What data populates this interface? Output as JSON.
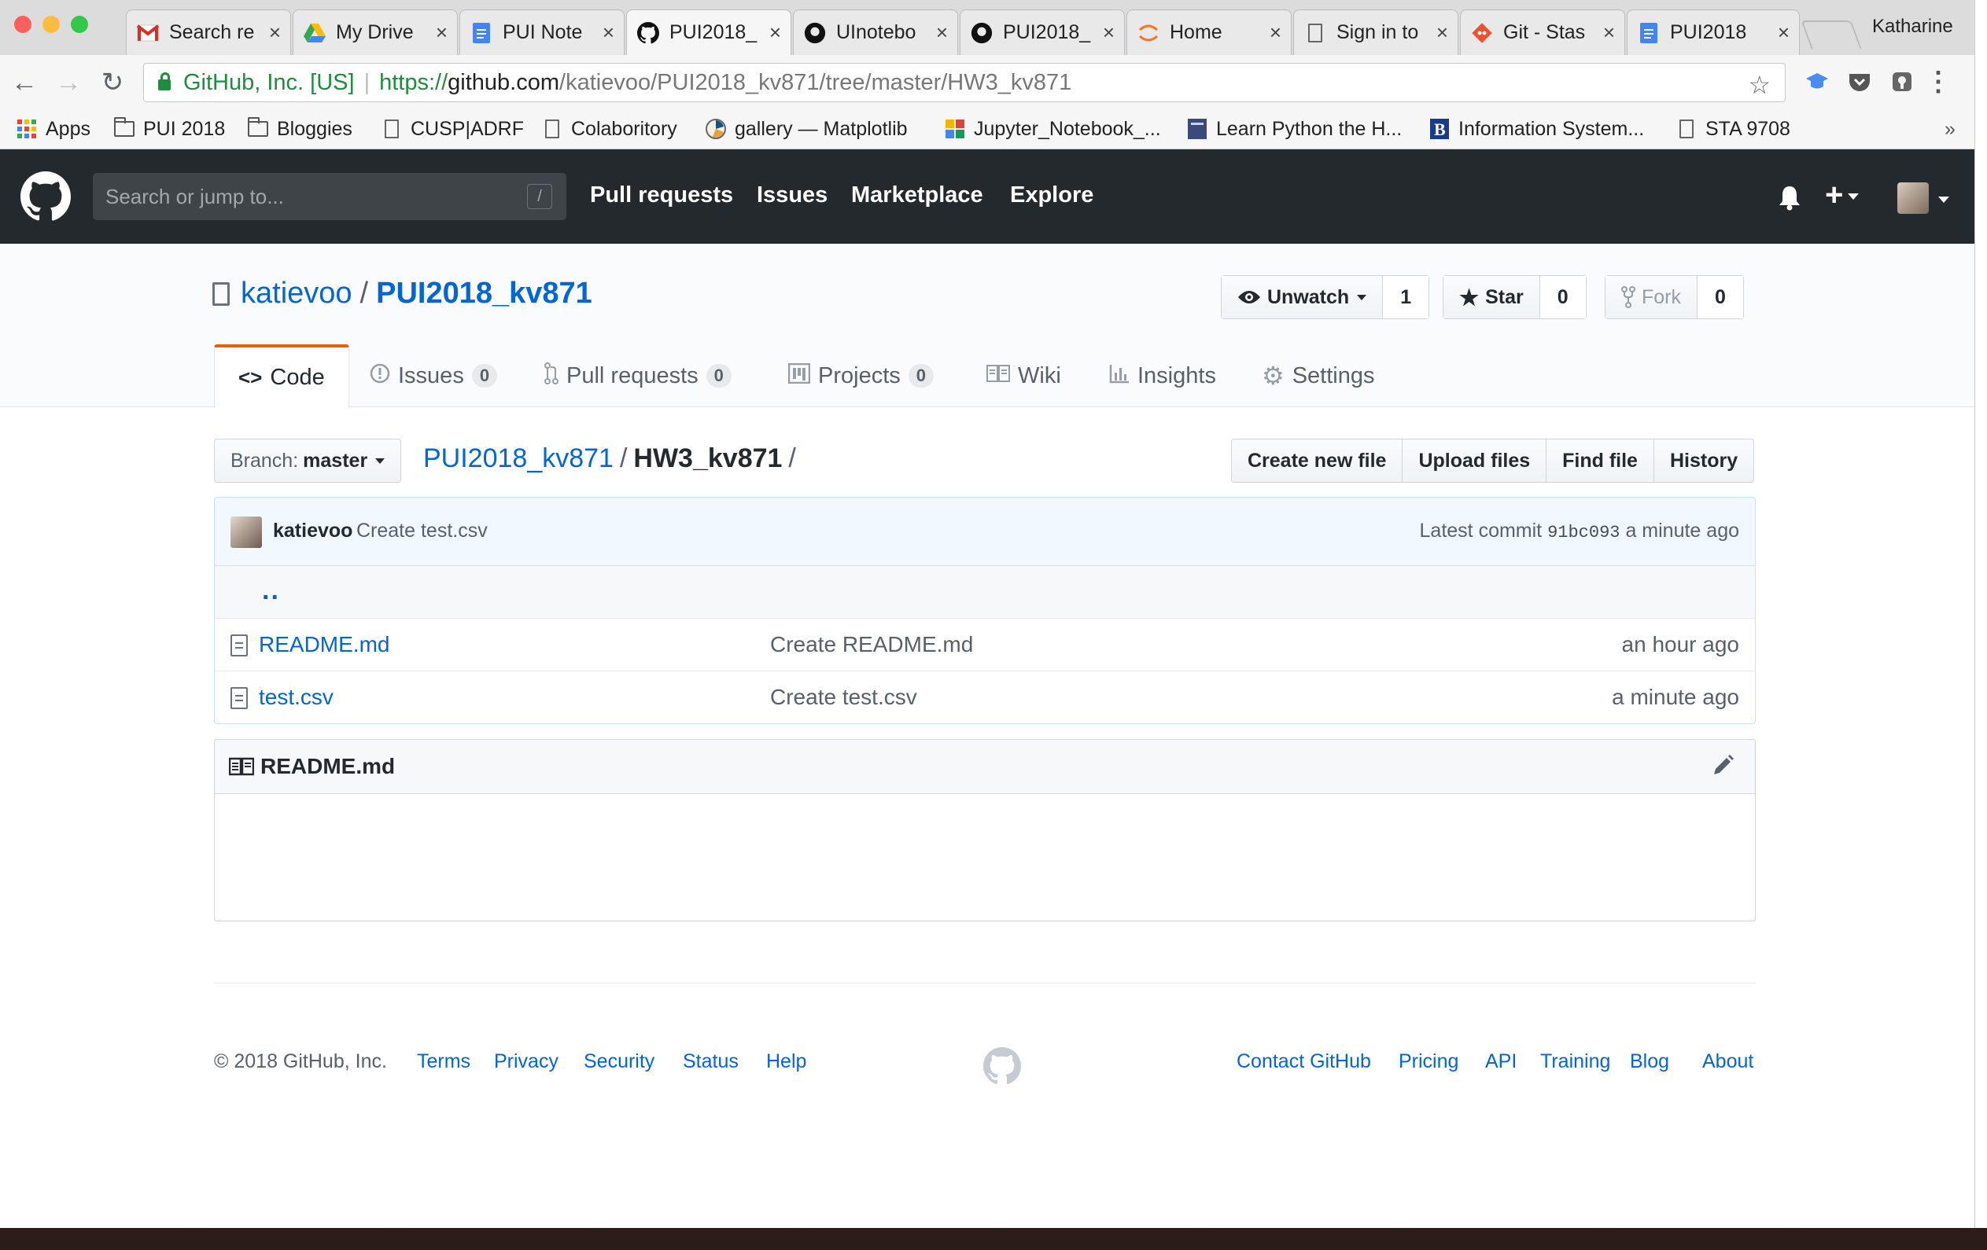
{
  "browser": {
    "tabs": [
      {
        "title": "Search re",
        "icon": "gmail-icon"
      },
      {
        "title": "My Drive",
        "icon": "google-drive-icon"
      },
      {
        "title": "PUI Note",
        "icon": "google-docs-icon"
      },
      {
        "title": "PUI2018_",
        "icon": "github-icon"
      },
      {
        "title": "UInotebo",
        "icon": "github-icon"
      },
      {
        "title": "PUI2018_",
        "icon": "github-icon"
      },
      {
        "title": "Home",
        "icon": "jupyter-icon"
      },
      {
        "title": "Sign in to",
        "icon": "page-icon"
      },
      {
        "title": "Git - Stas",
        "icon": "git-icon"
      },
      {
        "title": "PUI2018",
        "icon": "google-docs-icon"
      }
    ],
    "active_tab": 3,
    "close_glyph": "×",
    "profile_name": "Katharine",
    "address": {
      "secure_label": "GitHub, Inc. [US]",
      "separator": "|",
      "scheme": "https://",
      "host": "github.com",
      "path": "/katievoo/PUI2018_kv871/tree/master/HW3_kv871"
    },
    "bookmarks": [
      {
        "label": "Apps",
        "icon": "apps-grid-icon"
      },
      {
        "label": "PUI 2018",
        "icon": "folder-icon"
      },
      {
        "label": "Bloggies",
        "icon": "folder-icon"
      },
      {
        "label": "CUSP|ADRF",
        "icon": "page-icon"
      },
      {
        "label": "Colaboritory",
        "icon": "page-icon"
      },
      {
        "label": "gallery — Matplotlib",
        "icon": "matplotlib-icon"
      },
      {
        "label": "Jupyter_Notebook_...",
        "icon": "colorful-grid-icon"
      },
      {
        "label": "Learn Python the H...",
        "icon": "book-cover-icon"
      },
      {
        "label": "Information System...",
        "icon": "b-logo-icon"
      },
      {
        "label": "STA 9708",
        "icon": "page-icon"
      }
    ],
    "bookmarks_overflow": "»"
  },
  "github": {
    "search_placeholder": "Search or jump to...",
    "search_shortcut": "/",
    "nav": [
      "Pull requests",
      "Issues",
      "Marketplace",
      "Explore"
    ],
    "plus_label": "+"
  },
  "repo": {
    "owner": "katievoo",
    "separator": "/",
    "name": "PUI2018_kv871",
    "watch": {
      "label": "Unwatch",
      "count": "1"
    },
    "star": {
      "label": "Star",
      "count": "0"
    },
    "fork": {
      "label": "Fork",
      "count": "0"
    },
    "tabs": [
      {
        "label": "Code",
        "icon": "code-icon",
        "counter": ""
      },
      {
        "label": "Issues",
        "icon": "issue-opened-icon",
        "counter": "0"
      },
      {
        "label": "Pull requests",
        "icon": "git-pull-request-icon",
        "counter": "0"
      },
      {
        "label": "Projects",
        "icon": "project-icon",
        "counter": "0"
      },
      {
        "label": "Wiki",
        "icon": "book-icon",
        "counter": ""
      },
      {
        "label": "Insights",
        "icon": "graph-icon",
        "counter": ""
      },
      {
        "label": "Settings",
        "icon": "gear-icon",
        "counter": ""
      }
    ]
  },
  "filenav": {
    "branch_label": "Branch:",
    "branch_value": "master",
    "crumb_repo": "PUI2018_kv871",
    "crumb_current": "HW3_kv871",
    "crumb_sep": "/",
    "buttons": [
      "Create new file",
      "Upload files",
      "Find file",
      "History"
    ]
  },
  "commit": {
    "author": "katievoo",
    "message": "Create test.csv",
    "latest_label": "Latest commit",
    "sha": "91bc093",
    "age": "a minute ago"
  },
  "files": {
    "up_dir": "..",
    "rows": [
      {
        "name": "README.md",
        "message": "Create README.md",
        "age": "an hour ago"
      },
      {
        "name": "test.csv",
        "message": "Create test.csv",
        "age": "a minute ago"
      }
    ]
  },
  "readme": {
    "title": "README.md"
  },
  "footer": {
    "copyright": "© 2018 GitHub, Inc.",
    "left_links": [
      "Terms",
      "Privacy",
      "Security",
      "Status",
      "Help"
    ],
    "right_links": [
      "Contact GitHub",
      "Pricing",
      "API",
      "Training",
      "Blog",
      "About"
    ]
  },
  "colors": {
    "link": "#0366d6",
    "header_bg": "#24292e",
    "selected_tab_accent": "#e36209",
    "commit_bar_bg": "#f1f8ff",
    "secure_green": "#1e8e3e"
  }
}
